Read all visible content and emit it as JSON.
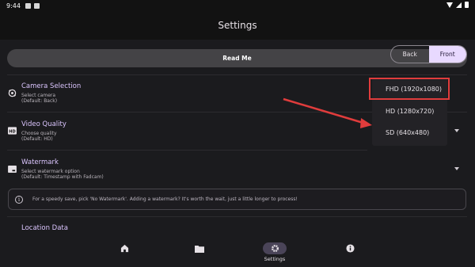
{
  "status_bar": {
    "time": "9:44"
  },
  "header": {
    "title": "Settings"
  },
  "readme_button": {
    "label": "Read Me"
  },
  "settings": {
    "camera": {
      "title": "Camera Selection",
      "subtitle": "Select camera",
      "default": "(Default: Back)",
      "options": [
        "Back",
        "Front"
      ],
      "selected": "Front"
    },
    "video_quality": {
      "title": "Video Quality",
      "subtitle": "Choose quality",
      "default": "(Default: HD)",
      "selected_value": "FHD (1920x1080)",
      "menu_items": [
        "HD (1280x720)",
        "SD (640x480)"
      ]
    },
    "watermark": {
      "title": "Watermark",
      "subtitle": "Select watermark option",
      "default": "(Default: Timestamp with Fadcam)"
    },
    "info_note": "For a speedy save, pick 'No Watermark'. Adding a watermark? It's worth the wait, just a little longer to process!",
    "location": {
      "title": "Location Data"
    }
  },
  "bottom_nav": {
    "items": [
      {
        "icon": "home-icon",
        "label": ""
      },
      {
        "icon": "folder-icon",
        "label": ""
      },
      {
        "icon": "gear-icon",
        "label": "Settings"
      },
      {
        "icon": "info-icon",
        "label": ""
      }
    ],
    "active_index": 2
  },
  "colors": {
    "accent": "#dcc6ff",
    "selected_segment": "#e8d9ff",
    "annotation_red": "#e03c3c",
    "background": "#121212"
  }
}
